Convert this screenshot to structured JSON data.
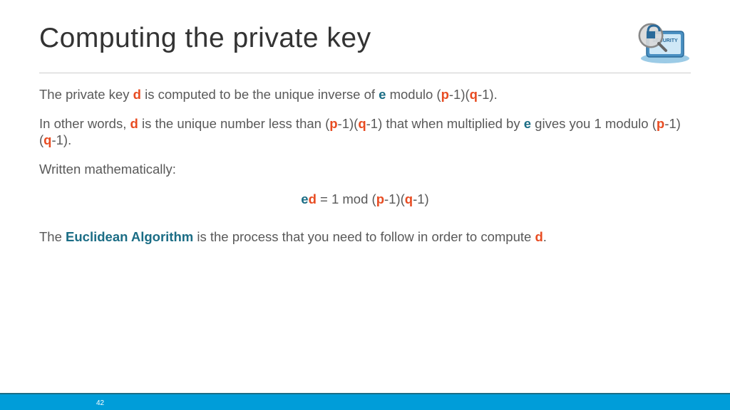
{
  "title": "Computing the private key",
  "line1": {
    "t1": "The private key ",
    "d": "d",
    "t2": " is computed to be the unique inverse of ",
    "e": "e",
    "t3": " modulo (",
    "p": "p",
    "t4": "-1)(",
    "q": "q",
    "t5": "-1)."
  },
  "line2": {
    "t1": "In other words, ",
    "d": "d",
    "t2": " is the unique number less than (",
    "p": "p",
    "t3": "-1)(",
    "q": "q",
    "t4": "-1) that when multiplied by ",
    "e": "e",
    "t5": " gives you 1 modulo (",
    "p2": "p",
    "t6": "-1)(",
    "q2": "q",
    "t7": "-1)."
  },
  "line3": "Written mathematically:",
  "equation": {
    "e": "e",
    "d": "d",
    "t1": " = 1 mod (",
    "p": "p",
    "t2": "-1)(",
    "q": "q",
    "t3": "-1)"
  },
  "line4": {
    "t1": "The ",
    "alg": "Euclidean Algorithm",
    "t2": " is the process that you need to follow in order to compute ",
    "d": "d",
    "t3": "."
  },
  "page_number": "42"
}
